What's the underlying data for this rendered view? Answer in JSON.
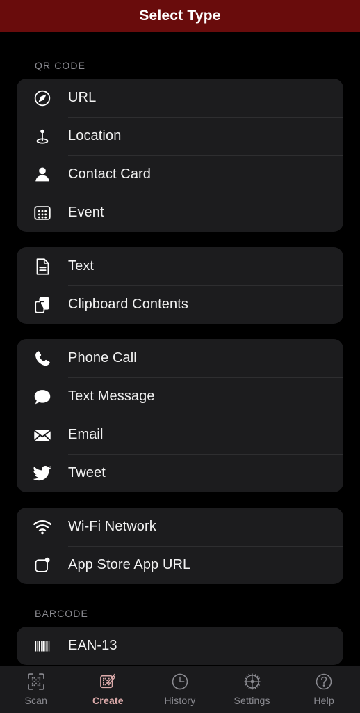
{
  "header": {
    "title": "Select Type"
  },
  "sections": [
    {
      "title": "QR CODE",
      "groups": [
        {
          "rows": [
            {
              "label": "URL",
              "icon": "compass-icon"
            },
            {
              "label": "Location",
              "icon": "map-pin-icon"
            },
            {
              "label": "Contact Card",
              "icon": "person-icon"
            },
            {
              "label": "Event",
              "icon": "calendar-icon"
            }
          ]
        },
        {
          "rows": [
            {
              "label": "Text",
              "icon": "document-icon"
            },
            {
              "label": "Clipboard Contents",
              "icon": "clipboard-icon"
            }
          ]
        },
        {
          "rows": [
            {
              "label": "Phone Call",
              "icon": "phone-icon"
            },
            {
              "label": "Text Message",
              "icon": "chat-bubble-icon"
            },
            {
              "label": "Email",
              "icon": "envelope-icon"
            },
            {
              "label": "Tweet",
              "icon": "twitter-bird-icon"
            }
          ]
        },
        {
          "rows": [
            {
              "label": "Wi-Fi Network",
              "icon": "wifi-icon"
            },
            {
              "label": "App Store App URL",
              "icon": "app-store-icon"
            }
          ]
        }
      ]
    },
    {
      "title": "BARCODE",
      "groups": [
        {
          "rows": [
            {
              "label": "EAN-13",
              "icon": "barcode-icon"
            }
          ]
        }
      ]
    }
  ],
  "tabbar": {
    "tabs": [
      {
        "label": "Scan",
        "icon": "qr-scan-icon",
        "active": false
      },
      {
        "label": "Create",
        "icon": "qr-create-icon",
        "active": true
      },
      {
        "label": "History",
        "icon": "clock-icon",
        "active": false
      },
      {
        "label": "Settings",
        "icon": "gear-icon",
        "active": false
      },
      {
        "label": "Help",
        "icon": "question-circle-icon",
        "active": false
      }
    ]
  },
  "colors": {
    "header_background": "#690c0c",
    "page_background": "#000000",
    "card_background": "#1c1c1e",
    "label_text": "#f2f2f2",
    "section_header_text": "#8a8a90",
    "tab_inactive": "#8a8a90",
    "tab_active": "#dbaaaa",
    "separator": "#2e2e30"
  }
}
